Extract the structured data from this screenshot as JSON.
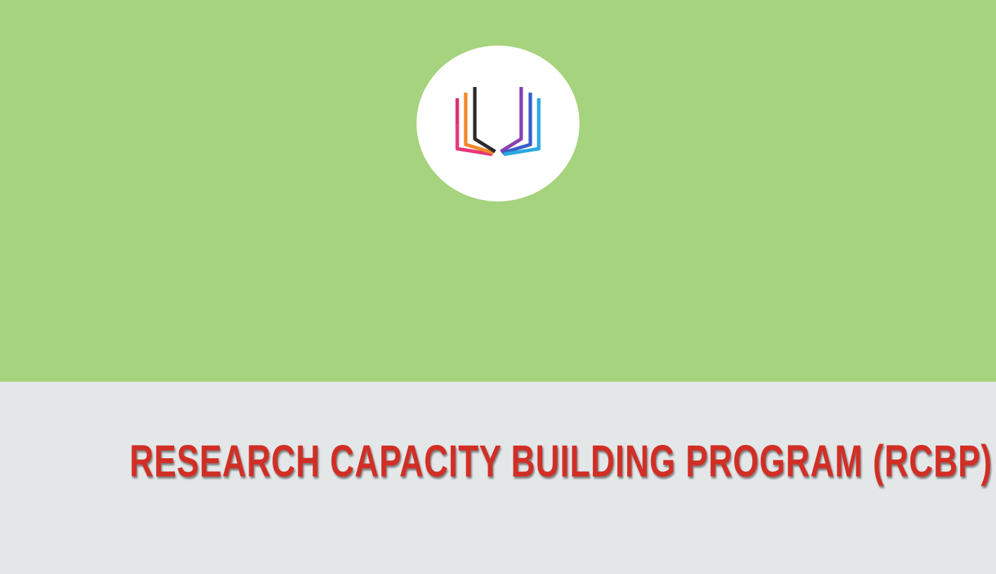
{
  "banner": {
    "title": "RESEARCH CAPACITY BUILDING PROGRAM (RCBP)"
  },
  "colors": {
    "top_background": "#a6d37d",
    "bottom_background": "#e4e7e8",
    "title_color": "#d12f26",
    "logo_background": "#ffffff"
  },
  "logo": {
    "icon": "open-book-icon"
  }
}
